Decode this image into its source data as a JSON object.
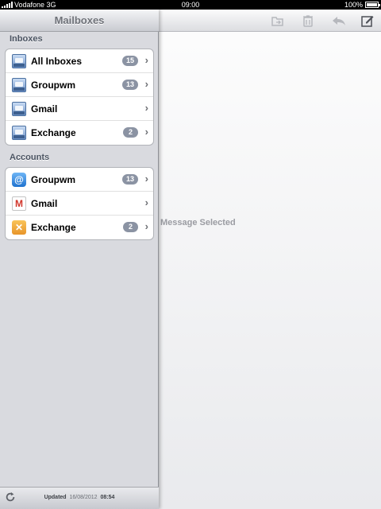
{
  "status": {
    "carrier": "Vodafone 3G",
    "time": "09:00",
    "battery": "100%"
  },
  "master": {
    "title": "Mailboxes",
    "inboxes_label": "Inboxes",
    "accounts_label": "Accounts",
    "inboxes": [
      {
        "label": "All Inboxes",
        "badge": "15",
        "icon": "inbox-icon"
      },
      {
        "label": "Groupwm",
        "badge": "13",
        "icon": "inbox-icon"
      },
      {
        "label": "Gmail",
        "badge": "",
        "icon": "inbox-icon"
      },
      {
        "label": "Exchange",
        "badge": "2",
        "icon": "inbox-icon"
      }
    ],
    "accounts": [
      {
        "label": "Groupwm",
        "badge": "13",
        "icon": "at-icon"
      },
      {
        "label": "Gmail",
        "badge": "",
        "icon": "gmail-icon"
      },
      {
        "label": "Exchange",
        "badge": "2",
        "icon": "exchange-icon"
      }
    ],
    "footer": {
      "updated_label": "Updated",
      "date": "16/08/2012",
      "time": "08:54"
    }
  },
  "detail": {
    "message": "Message Selected",
    "toolbar_icons": [
      "move-folder-icon",
      "trash-icon",
      "reply-icon",
      "compose-icon"
    ]
  }
}
